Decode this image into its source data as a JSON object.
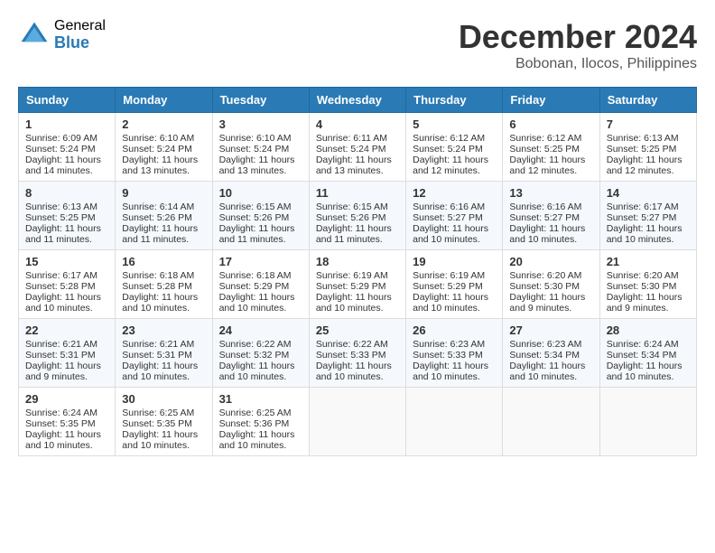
{
  "logo": {
    "general": "General",
    "blue": "Blue"
  },
  "title": {
    "month_year": "December 2024",
    "location": "Bobonan, Ilocos, Philippines"
  },
  "days_of_week": [
    "Sunday",
    "Monday",
    "Tuesday",
    "Wednesday",
    "Thursday",
    "Friday",
    "Saturday"
  ],
  "weeks": [
    [
      {
        "day": "1",
        "sunrise": "Sunrise: 6:09 AM",
        "sunset": "Sunset: 5:24 PM",
        "daylight": "Daylight: 11 hours and 14 minutes."
      },
      {
        "day": "2",
        "sunrise": "Sunrise: 6:10 AM",
        "sunset": "Sunset: 5:24 PM",
        "daylight": "Daylight: 11 hours and 13 minutes."
      },
      {
        "day": "3",
        "sunrise": "Sunrise: 6:10 AM",
        "sunset": "Sunset: 5:24 PM",
        "daylight": "Daylight: 11 hours and 13 minutes."
      },
      {
        "day": "4",
        "sunrise": "Sunrise: 6:11 AM",
        "sunset": "Sunset: 5:24 PM",
        "daylight": "Daylight: 11 hours and 13 minutes."
      },
      {
        "day": "5",
        "sunrise": "Sunrise: 6:12 AM",
        "sunset": "Sunset: 5:24 PM",
        "daylight": "Daylight: 11 hours and 12 minutes."
      },
      {
        "day": "6",
        "sunrise": "Sunrise: 6:12 AM",
        "sunset": "Sunset: 5:25 PM",
        "daylight": "Daylight: 11 hours and 12 minutes."
      },
      {
        "day": "7",
        "sunrise": "Sunrise: 6:13 AM",
        "sunset": "Sunset: 5:25 PM",
        "daylight": "Daylight: 11 hours and 12 minutes."
      }
    ],
    [
      {
        "day": "8",
        "sunrise": "Sunrise: 6:13 AM",
        "sunset": "Sunset: 5:25 PM",
        "daylight": "Daylight: 11 hours and 11 minutes."
      },
      {
        "day": "9",
        "sunrise": "Sunrise: 6:14 AM",
        "sunset": "Sunset: 5:26 PM",
        "daylight": "Daylight: 11 hours and 11 minutes."
      },
      {
        "day": "10",
        "sunrise": "Sunrise: 6:15 AM",
        "sunset": "Sunset: 5:26 PM",
        "daylight": "Daylight: 11 hours and 11 minutes."
      },
      {
        "day": "11",
        "sunrise": "Sunrise: 6:15 AM",
        "sunset": "Sunset: 5:26 PM",
        "daylight": "Daylight: 11 hours and 11 minutes."
      },
      {
        "day": "12",
        "sunrise": "Sunrise: 6:16 AM",
        "sunset": "Sunset: 5:27 PM",
        "daylight": "Daylight: 11 hours and 10 minutes."
      },
      {
        "day": "13",
        "sunrise": "Sunrise: 6:16 AM",
        "sunset": "Sunset: 5:27 PM",
        "daylight": "Daylight: 11 hours and 10 minutes."
      },
      {
        "day": "14",
        "sunrise": "Sunrise: 6:17 AM",
        "sunset": "Sunset: 5:27 PM",
        "daylight": "Daylight: 11 hours and 10 minutes."
      }
    ],
    [
      {
        "day": "15",
        "sunrise": "Sunrise: 6:17 AM",
        "sunset": "Sunset: 5:28 PM",
        "daylight": "Daylight: 11 hours and 10 minutes."
      },
      {
        "day": "16",
        "sunrise": "Sunrise: 6:18 AM",
        "sunset": "Sunset: 5:28 PM",
        "daylight": "Daylight: 11 hours and 10 minutes."
      },
      {
        "day": "17",
        "sunrise": "Sunrise: 6:18 AM",
        "sunset": "Sunset: 5:29 PM",
        "daylight": "Daylight: 11 hours and 10 minutes."
      },
      {
        "day": "18",
        "sunrise": "Sunrise: 6:19 AM",
        "sunset": "Sunset: 5:29 PM",
        "daylight": "Daylight: 11 hours and 10 minutes."
      },
      {
        "day": "19",
        "sunrise": "Sunrise: 6:19 AM",
        "sunset": "Sunset: 5:29 PM",
        "daylight": "Daylight: 11 hours and 10 minutes."
      },
      {
        "day": "20",
        "sunrise": "Sunrise: 6:20 AM",
        "sunset": "Sunset: 5:30 PM",
        "daylight": "Daylight: 11 hours and 9 minutes."
      },
      {
        "day": "21",
        "sunrise": "Sunrise: 6:20 AM",
        "sunset": "Sunset: 5:30 PM",
        "daylight": "Daylight: 11 hours and 9 minutes."
      }
    ],
    [
      {
        "day": "22",
        "sunrise": "Sunrise: 6:21 AM",
        "sunset": "Sunset: 5:31 PM",
        "daylight": "Daylight: 11 hours and 9 minutes."
      },
      {
        "day": "23",
        "sunrise": "Sunrise: 6:21 AM",
        "sunset": "Sunset: 5:31 PM",
        "daylight": "Daylight: 11 hours and 10 minutes."
      },
      {
        "day": "24",
        "sunrise": "Sunrise: 6:22 AM",
        "sunset": "Sunset: 5:32 PM",
        "daylight": "Daylight: 11 hours and 10 minutes."
      },
      {
        "day": "25",
        "sunrise": "Sunrise: 6:22 AM",
        "sunset": "Sunset: 5:33 PM",
        "daylight": "Daylight: 11 hours and 10 minutes."
      },
      {
        "day": "26",
        "sunrise": "Sunrise: 6:23 AM",
        "sunset": "Sunset: 5:33 PM",
        "daylight": "Daylight: 11 hours and 10 minutes."
      },
      {
        "day": "27",
        "sunrise": "Sunrise: 6:23 AM",
        "sunset": "Sunset: 5:34 PM",
        "daylight": "Daylight: 11 hours and 10 minutes."
      },
      {
        "day": "28",
        "sunrise": "Sunrise: 6:24 AM",
        "sunset": "Sunset: 5:34 PM",
        "daylight": "Daylight: 11 hours and 10 minutes."
      }
    ],
    [
      {
        "day": "29",
        "sunrise": "Sunrise: 6:24 AM",
        "sunset": "Sunset: 5:35 PM",
        "daylight": "Daylight: 11 hours and 10 minutes."
      },
      {
        "day": "30",
        "sunrise": "Sunrise: 6:25 AM",
        "sunset": "Sunset: 5:35 PM",
        "daylight": "Daylight: 11 hours and 10 minutes."
      },
      {
        "day": "31",
        "sunrise": "Sunrise: 6:25 AM",
        "sunset": "Sunset: 5:36 PM",
        "daylight": "Daylight: 11 hours and 10 minutes."
      },
      {
        "day": "",
        "sunrise": "",
        "sunset": "",
        "daylight": ""
      },
      {
        "day": "",
        "sunrise": "",
        "sunset": "",
        "daylight": ""
      },
      {
        "day": "",
        "sunrise": "",
        "sunset": "",
        "daylight": ""
      },
      {
        "day": "",
        "sunrise": "",
        "sunset": "",
        "daylight": ""
      }
    ]
  ]
}
